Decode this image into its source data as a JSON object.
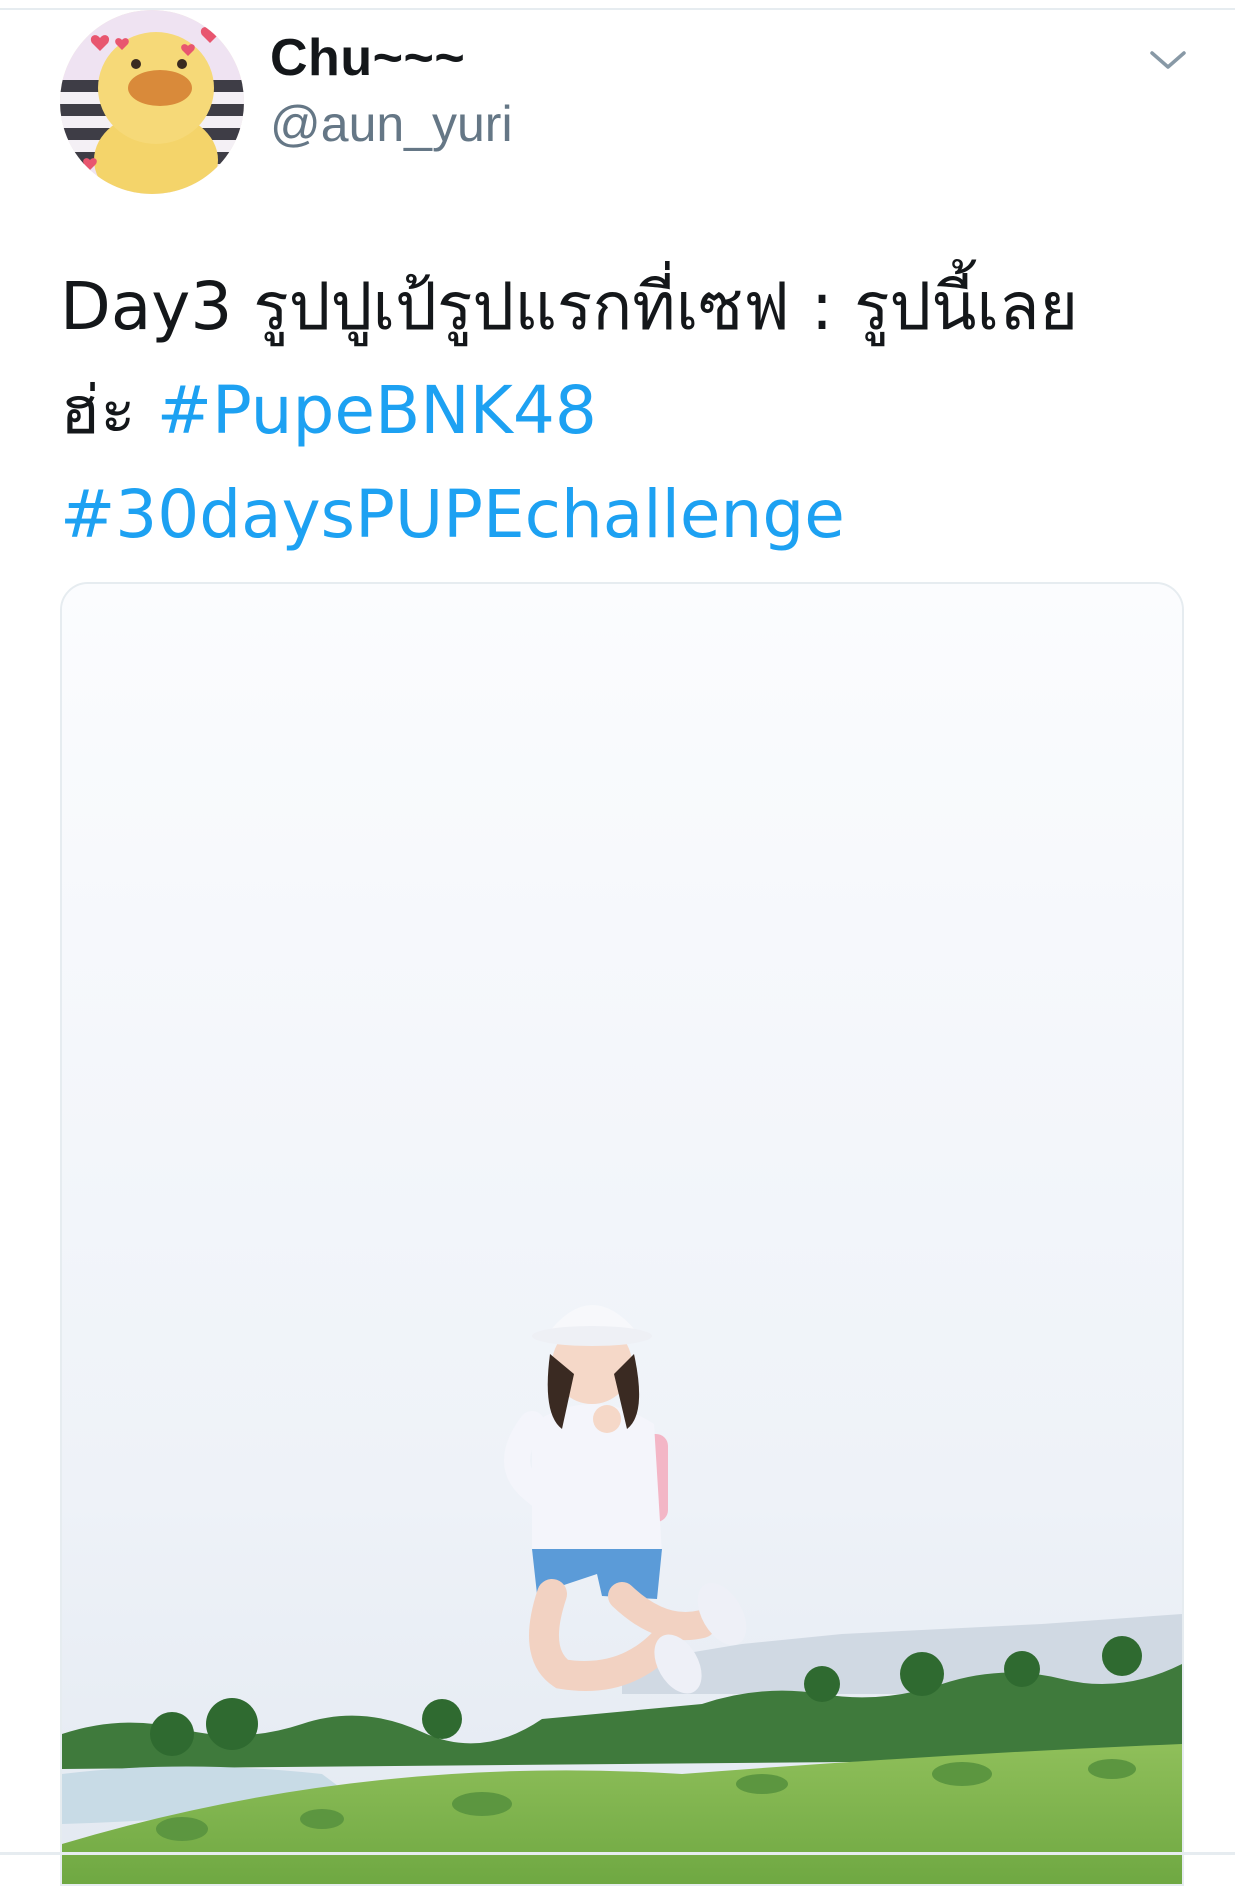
{
  "tweet": {
    "author": {
      "display_name": "Chu~~~",
      "username": "@aun_yuri",
      "avatar_icon": "plush-duck-avatar"
    },
    "menu_icon": "chevron-down-icon",
    "text_line1": "Day3 รูปปูเป้รูปแรกที่เซฟ : รูปนี้เลย",
    "text_line2_prefix": "ฮ่ะ ",
    "hashtag1": "#PupeBNK48",
    "hashtag2": "#30daysPUPEchallenge",
    "media_icon": "photo-girl-jumping-on-hill"
  },
  "colors": {
    "text": "#14171a",
    "secondary": "#657786",
    "link": "#1da1f2",
    "divider": "#e6ecf0"
  }
}
